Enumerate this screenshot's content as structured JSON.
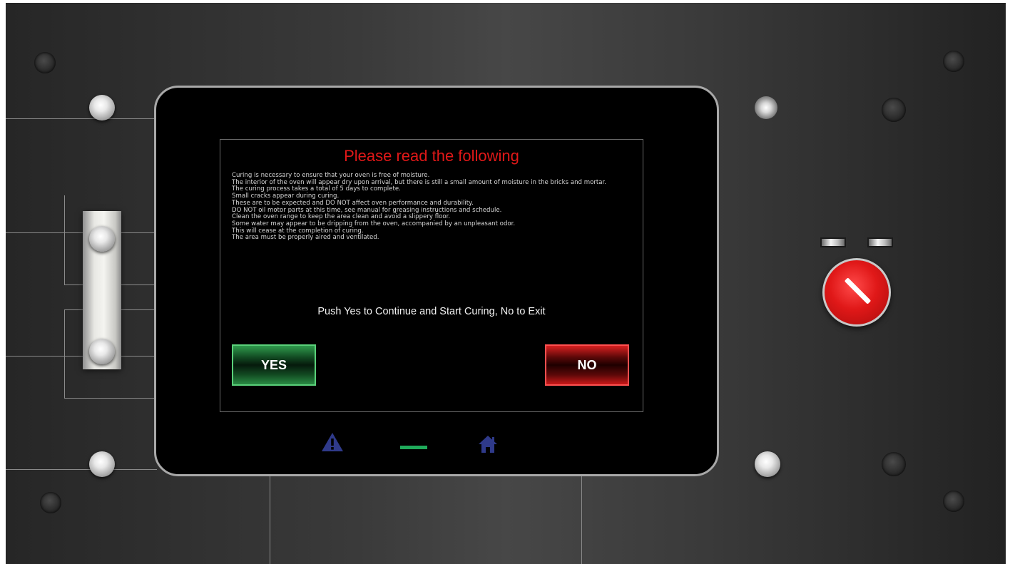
{
  "dialog": {
    "title": "Please read the following",
    "lines": [
      "Curing is necessary to ensure that your oven is free of moisture.",
      "The interior of the oven will appear dry upon arrival, but there is still a small amount of moisture in the bricks and mortar.",
      "The curing process takes a total of 5 days to complete.",
      "Small cracks appear during curing.",
      "These are to be expected and DO NOT affect oven performance and durability.",
      "DO NOT oil motor parts at this time, see manual for greasing instructions and schedule.",
      "Clean the oven range to keep the area clean and avoid a slippery floor.",
      "Some water may appear to be dripping from the oven, accompanied by an unpleasant odor.",
      "This will cease at the completion of curing.",
      "The area must be properly aired and ventilated."
    ],
    "prompt": "Push Yes to Continue and Start Curing, No to Exit",
    "yes_label": "YES",
    "no_label": "NO"
  },
  "footer": {
    "icons": [
      "warning-icon",
      "status-indicator",
      "home-icon"
    ]
  },
  "colors": {
    "title": "#e01818",
    "yes_button": "#1f7a3a",
    "no_button": "#c81818",
    "status_bar": "#1faa5a",
    "icon": "#2f3a8a"
  },
  "controls": {
    "selector_switch": "red-selector-switch",
    "indicators": [
      "indicator-light-1",
      "indicator-light-2"
    ]
  }
}
